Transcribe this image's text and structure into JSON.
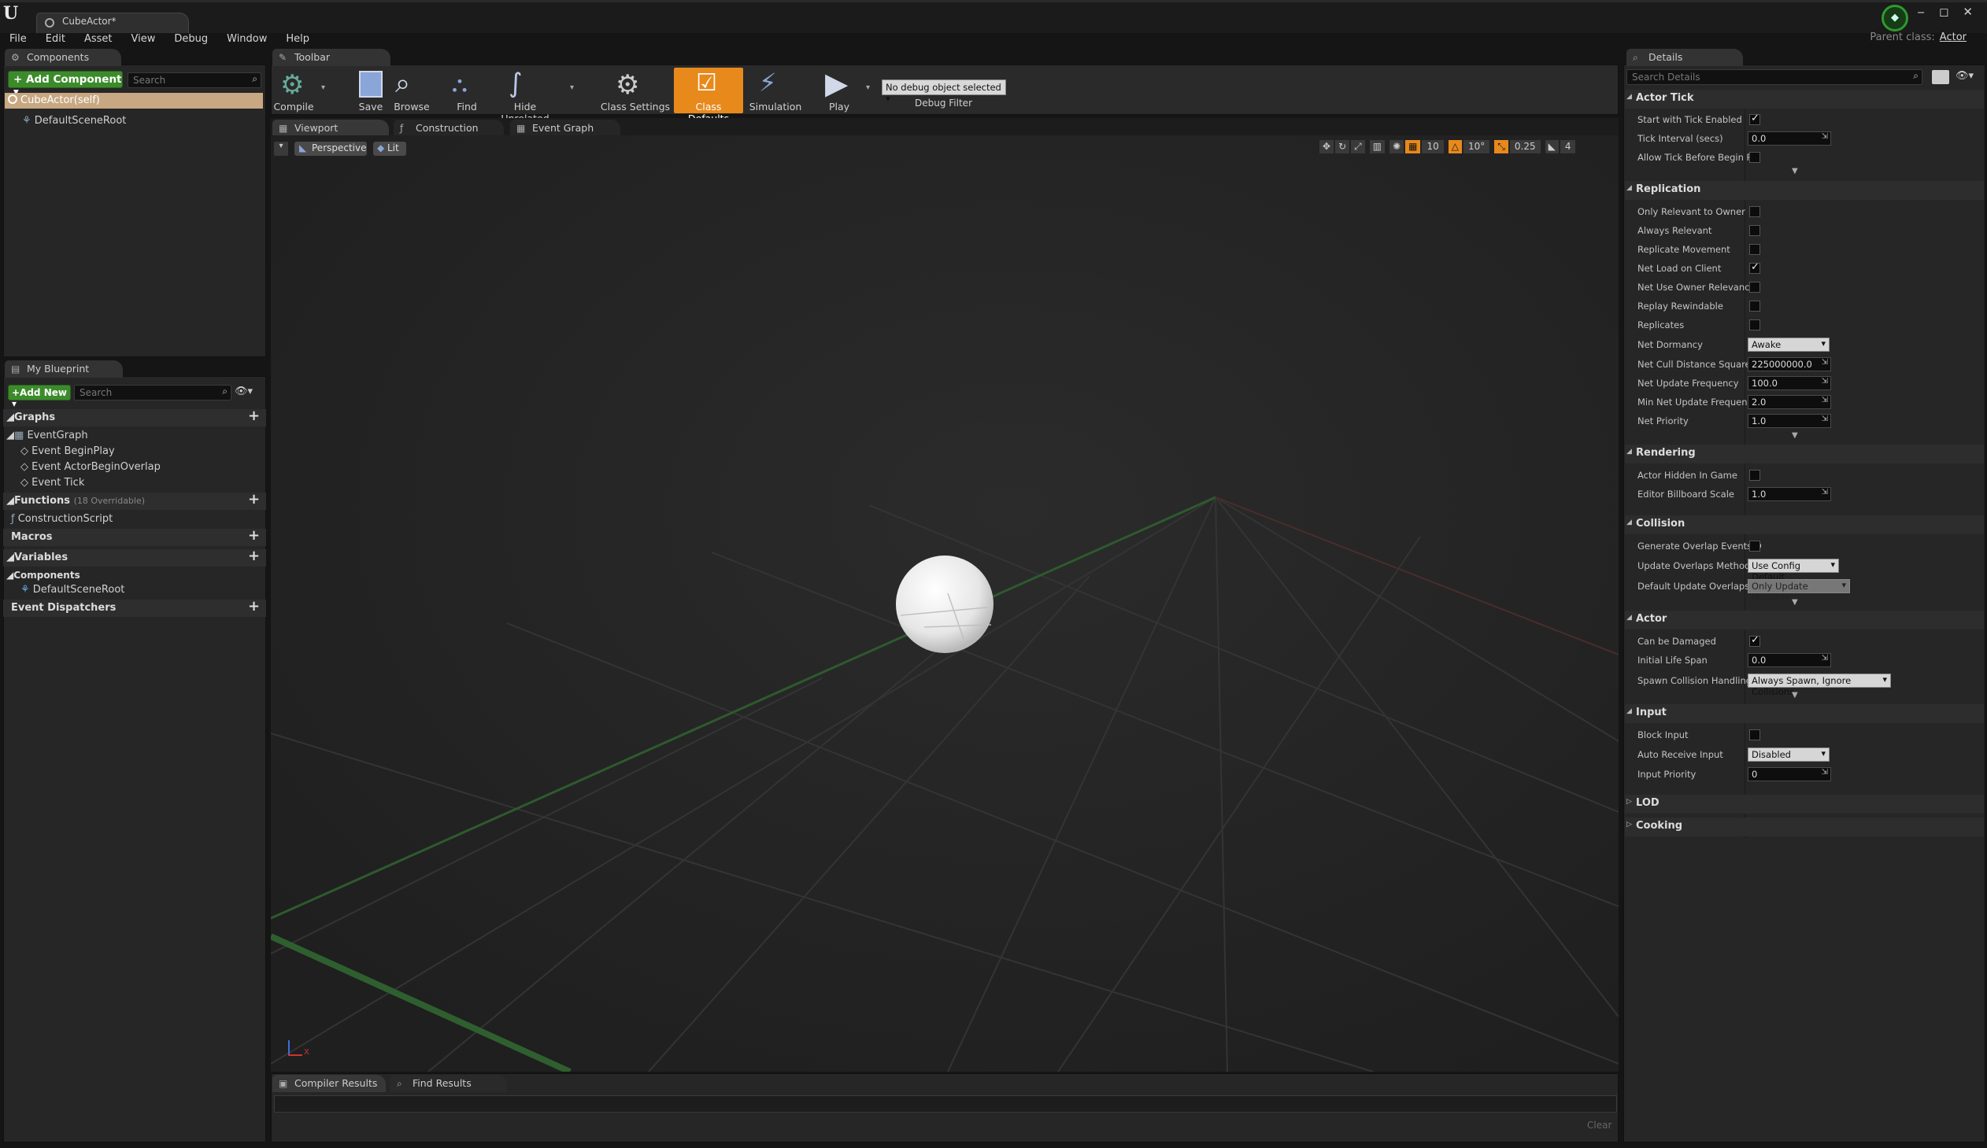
{
  "window": {
    "doc_tab": "CubeActor*",
    "parent_class_label": "Parent class:",
    "parent_class_value": "Actor",
    "controls": [
      "‒",
      "◻",
      "✕"
    ]
  },
  "menu": [
    "File",
    "Edit",
    "Asset",
    "View",
    "Debug",
    "Window",
    "Help"
  ],
  "components_panel": {
    "tab": "Components",
    "add_button": "+ Add Component ▾",
    "search_placeholder": "Search",
    "root_item": "CubeActor(self)",
    "child_item": "DefaultSceneRoot"
  },
  "my_blueprint": {
    "tab": "My Blueprint",
    "add_button": "+Add New ▾",
    "search_placeholder": "Search",
    "graphs_label": "Graphs",
    "event_graph": "EventGraph",
    "events": [
      "Event BeginPlay",
      "Event ActorBeginOverlap",
      "Event Tick"
    ],
    "functions_label": "Functions",
    "functions_note": "(18 Overridable)",
    "construction_script": "ConstructionScript",
    "macros_label": "Macros",
    "variables_label": "Variables",
    "components_label": "Components",
    "component_item": "DefaultSceneRoot",
    "dispatchers_label": "Event Dispatchers"
  },
  "toolbar": {
    "tab": "Toolbar",
    "buttons": [
      "Compile",
      "Save",
      "Browse",
      "Find",
      "Hide Unrelated",
      "Class Settings",
      "Class Defaults",
      "Simulation",
      "Play"
    ],
    "debug_select": "No debug object selected",
    "debug_label": "Debug Filter"
  },
  "editor_tabs": [
    "Viewport",
    "Construction Scrip",
    "Event Graph"
  ],
  "viewport": {
    "perspective": "Perspective",
    "lit": "Lit",
    "grid_snap": "10",
    "rot_snap": "10°",
    "scale_snap": "0.25",
    "cam_speed": "4",
    "axis_x": "X"
  },
  "bottom_tabs": [
    "Compiler Results",
    "Find Results"
  ],
  "clear_label": "Clear",
  "details": {
    "tab": "Details",
    "search_placeholder": "Search Details",
    "sections": {
      "actor_tick": "Actor Tick",
      "replication": "Replication",
      "rendering": "Rendering",
      "collision": "Collision",
      "actor": "Actor",
      "input": "Input",
      "lod": "LOD",
      "cooking": "Cooking"
    },
    "props": {
      "start_tick": "Start with Tick Enabled",
      "tick_interval": "Tick Interval (secs)",
      "tick_interval_val": "0.0",
      "allow_tick": "Allow Tick Before Begin Pla",
      "only_relevant": "Only Relevant to Owner",
      "always_relevant": "Always Relevant",
      "replicate_movement": "Replicate Movement",
      "net_load": "Net Load on Client",
      "net_use_owner": "Net Use Owner Relevancy",
      "replay_rewind": "Replay Rewindable",
      "replicates": "Replicates",
      "net_dormancy": "Net Dormancy",
      "net_dormancy_val": "Awake",
      "net_cull": "Net Cull Distance Squared",
      "net_cull_val": "225000000.0",
      "net_update": "Net Update Frequency",
      "net_update_val": "100.0",
      "min_net_update": "Min Net Update Frequency",
      "min_net_update_val": "2.0",
      "net_priority": "Net Priority",
      "net_priority_val": "1.0",
      "hidden_in_game": "Actor Hidden In Game",
      "billboard_scale": "Editor Billboard Scale",
      "billboard_scale_val": "1.0",
      "gen_overlap": "Generate Overlap Events D",
      "update_overlap": "Update Overlaps Method D",
      "update_overlap_val": "Use Config Default",
      "default_update_overlap": "Default Update Overlaps M",
      "default_update_overlap_val": "Only Update Movable",
      "can_be_damaged": "Can be Damaged",
      "life_span": "Initial Life Span",
      "life_span_val": "0.0",
      "spawn_collision": "Spawn Collision Handling M",
      "spawn_collision_val": "Always Spawn, Ignore Collisions",
      "block_input": "Block Input",
      "auto_receive": "Auto Receive Input",
      "auto_receive_val": "Disabled",
      "input_priority": "Input Priority",
      "input_priority_val": "0"
    }
  },
  "colors": {
    "accent_orange": "#e8891c",
    "green_button": "#3c8b2b",
    "selection": "#c8a882"
  }
}
